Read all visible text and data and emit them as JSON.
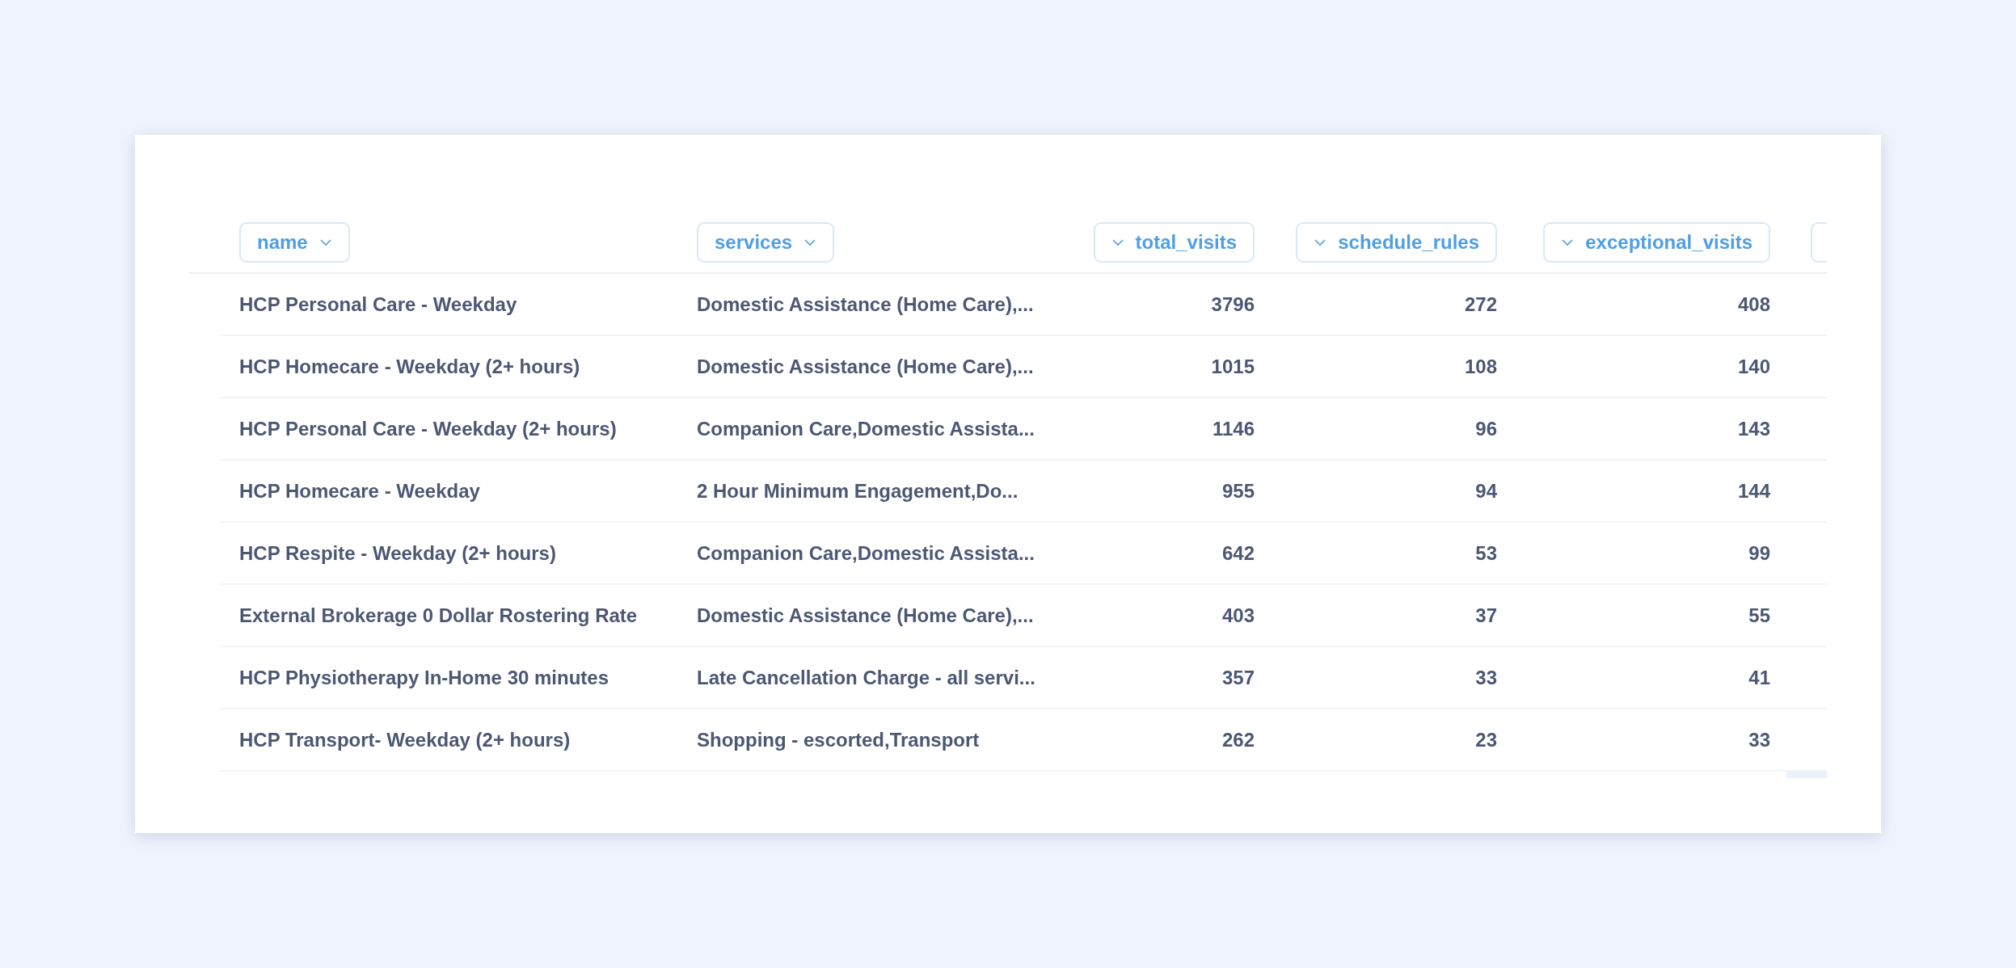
{
  "table": {
    "columns": [
      {
        "label": "name",
        "kind": "text"
      },
      {
        "label": "services",
        "kind": "text"
      },
      {
        "label": "total_visits",
        "kind": "number"
      },
      {
        "label": "schedule_rules",
        "kind": "number"
      },
      {
        "label": "exceptional_visits",
        "kind": "number"
      }
    ],
    "rows": [
      [
        "HCP Personal Care - Weekday",
        "Domestic Assistance (Home Care),...",
        "3796",
        "272",
        "408"
      ],
      [
        "HCP Homecare - Weekday (2+ hours)",
        "Domestic Assistance (Home Care),...",
        "1015",
        "108",
        "140"
      ],
      [
        "HCP Personal Care - Weekday (2+ hours)",
        "Companion Care,Domestic Assista...",
        "1146",
        "96",
        "143"
      ],
      [
        "HCP Homecare - Weekday",
        "2 Hour Minimum Engagement,Do...",
        "955",
        "94",
        "144"
      ],
      [
        "HCP Respite - Weekday (2+ hours)",
        "Companion Care,Domestic Assista...",
        "642",
        "53",
        "99"
      ],
      [
        "External Brokerage 0 Dollar Rostering Rate",
        "Domestic Assistance (Home Care),...",
        "403",
        "37",
        "55"
      ],
      [
        "HCP Physiotherapy In-Home 30 minutes",
        "Late Cancellation Charge - all servi...",
        "357",
        "33",
        "41"
      ],
      [
        "HCP Transport- Weekday (2+ hours)",
        "Shopping - escorted,Transport",
        "262",
        "23",
        "33"
      ]
    ]
  }
}
